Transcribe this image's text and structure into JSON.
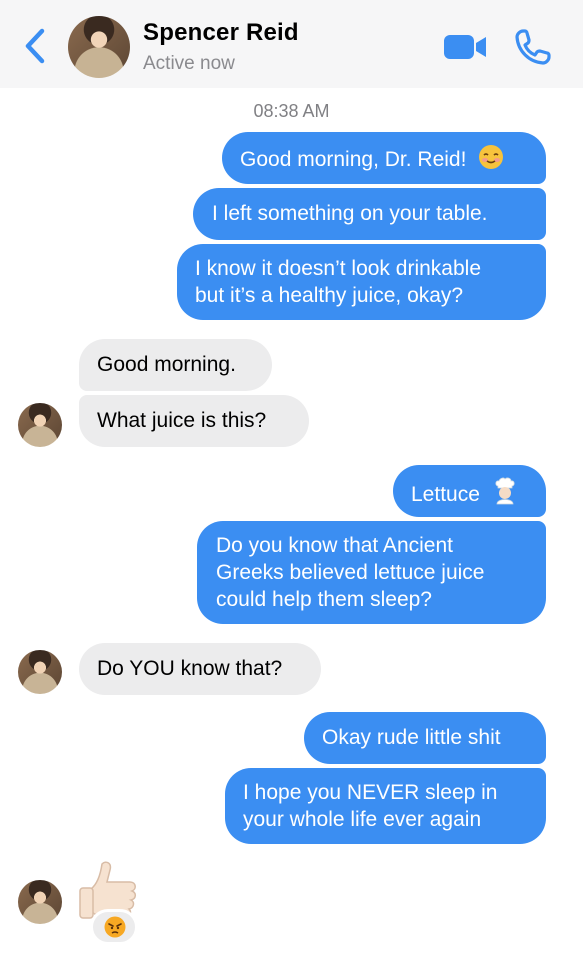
{
  "header": {
    "name": "Spencer Reid",
    "status": "Active now",
    "accent": "#3b8ef2"
  },
  "timestamp": "08:38 AM",
  "messages": [
    {
      "from": "me",
      "lines": [
        "Good morning, Dr. Reid!"
      ],
      "emoji": "smiling-blush-emoji"
    },
    {
      "from": "me",
      "lines": [
        "I left something on your table."
      ]
    },
    {
      "from": "me",
      "lines": [
        "I know it doesn’t look drinkable",
        "but it’s a healthy juice, okay?"
      ]
    },
    {
      "from": "them",
      "lines": [
        "Good morning."
      ]
    },
    {
      "from": "them",
      "lines": [
        "What juice is this?"
      ]
    },
    {
      "from": "me",
      "lines": [
        "Lettuce"
      ],
      "emoji": "chef-emoji"
    },
    {
      "from": "me",
      "lines": [
        "Do you know that Ancient",
        "Greeks believed lettuce juice",
        "could help them sleep?"
      ]
    },
    {
      "from": "them",
      "lines": [
        "Do YOU know that?"
      ]
    },
    {
      "from": "me",
      "lines": [
        "Okay rude little shit"
      ]
    },
    {
      "from": "me",
      "lines": [
        "I hope you NEVER sleep in",
        "your whole life ever again"
      ]
    },
    {
      "from": "them",
      "lines": [],
      "emoji": "thumbs-up-emoji",
      "reaction": "angry-face-emoji"
    }
  ],
  "colors": {
    "outgoing": "#3b8ef2",
    "incoming": "#ececed",
    "header_bg": "#f6f6f7"
  }
}
